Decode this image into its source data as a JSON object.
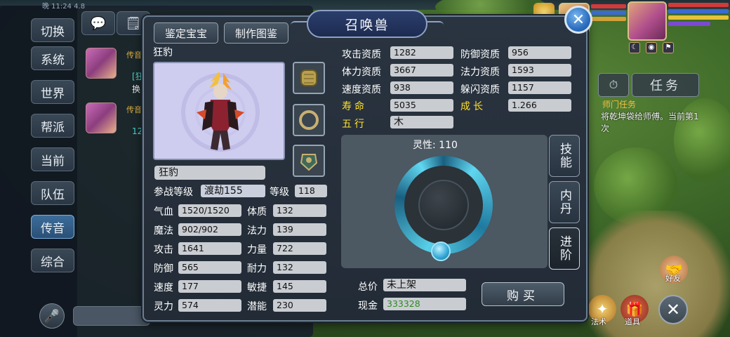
{
  "chat": {
    "time_partial": "晚 11:24 4.8",
    "tabs": [
      {
        "label": "切换"
      },
      {
        "label": "系统"
      },
      {
        "label": "世界"
      },
      {
        "label": "帮派"
      },
      {
        "label": "当前"
      },
      {
        "label": "队伍"
      },
      {
        "label": "传音"
      },
      {
        "label": "综合"
      }
    ],
    "active_tab": "传音",
    "messages": [
      {
        "tag": "传音",
        "line1": "[狂",
        "line2": "换"
      },
      {
        "tag": "传音",
        "line1": "12"
      }
    ]
  },
  "dialog": {
    "title": "召唤兽",
    "buttons": {
      "identify": "鉴定宝宝",
      "make_guide": "制作图鉴"
    },
    "pet_name": "狂豹",
    "pet_name_field": "狂豹",
    "battle_level_label": "参战等级",
    "battle_level_value": "渡劫155",
    "level_label": "等级",
    "level_value": "118",
    "attrs_left": [
      {
        "label": "气血",
        "value": "1520/1520"
      },
      {
        "label": "魔法",
        "value": "902/902"
      },
      {
        "label": "攻击",
        "value": "1641"
      },
      {
        "label": "防御",
        "value": "565"
      },
      {
        "label": "速度",
        "value": "177"
      },
      {
        "label": "灵力",
        "value": "574"
      }
    ],
    "attrs_right": [
      {
        "label": "体质",
        "value": "132"
      },
      {
        "label": "法力",
        "value": "139"
      },
      {
        "label": "力量",
        "value": "722"
      },
      {
        "label": "耐力",
        "value": "132"
      },
      {
        "label": "敏捷",
        "value": "145"
      },
      {
        "label": "潜能",
        "value": "230"
      }
    ],
    "aptitudes": [
      {
        "label": "攻击资质",
        "value": "1282"
      },
      {
        "label": "防御资质",
        "value": "956"
      },
      {
        "label": "体力资质",
        "value": "3667"
      },
      {
        "label": "法力资质",
        "value": "1593"
      },
      {
        "label": "速度资质",
        "value": "938"
      },
      {
        "label": "躲闪资质",
        "value": "1157"
      }
    ],
    "lifespan_label": "寿命",
    "lifespan_value": "5035",
    "growth_label": "成长",
    "growth_value": "1.266",
    "element_label": "五行",
    "element_value": "木",
    "spirit_label": "灵性: 110",
    "side_tabs": [
      "技能",
      "内丹",
      "进阶"
    ],
    "price_label": "总价",
    "price_value": "未上架",
    "cash_label": "现金",
    "cash_value": "333328",
    "buy_label": "购买"
  },
  "hud": {
    "task_button": "任务",
    "task_title": "师门任务",
    "task_desc": "将乾坤袋给师傅。当前第1次",
    "friends_label": "好友",
    "spell_label": "法术",
    "items_label": "道具"
  },
  "colors": {
    "accent_yellow": "#ffe02a",
    "field_bg": "#c9cdd2",
    "cash_green": "#2e8a1e",
    "ring_cyan": "#5fd6f0"
  }
}
